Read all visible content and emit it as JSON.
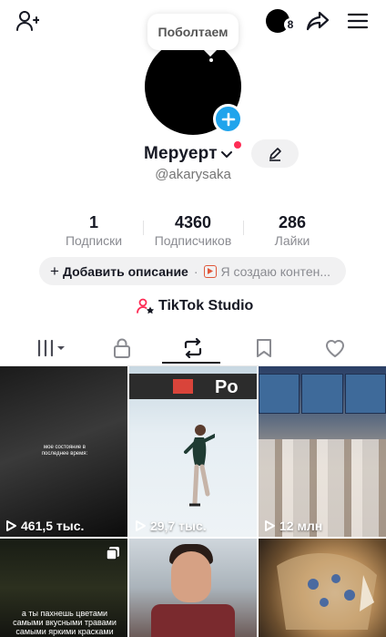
{
  "colors": {
    "accent_blue": "#20a4ec",
    "accent_red": "#fe2c55",
    "text_primary": "#161823",
    "text_secondary": "#8a8b91",
    "pill_bg": "#f1f1f2"
  },
  "topbar": {
    "icons": [
      "add-friend-icon",
      "story-avatar",
      "share-icon",
      "menu-icon"
    ],
    "story_badge_count": "8"
  },
  "profile": {
    "tooltip": "Поболтаем",
    "name": "Меруерт",
    "username": "@akarysaka"
  },
  "stats": [
    {
      "value": "1",
      "label": "Подписки"
    },
    {
      "value": "4360",
      "label": "Подписчиков"
    },
    {
      "value": "286",
      "label": "Лайки"
    }
  ],
  "bio": {
    "add_label": "Добавить описание",
    "separator": "·",
    "creator_text": "Я создаю контен..."
  },
  "studio": {
    "label": "TikTok Studio"
  },
  "tabs": [
    {
      "name": "videos",
      "icon": "grid-bars-icon",
      "selected": false
    },
    {
      "name": "private",
      "icon": "lock-icon",
      "selected": false
    },
    {
      "name": "reposts",
      "icon": "repost-icon",
      "selected": true
    },
    {
      "name": "favorites",
      "icon": "bookmark-icon",
      "selected": false
    },
    {
      "name": "liked",
      "icon": "heart-icon",
      "selected": false
    }
  ],
  "videos": [
    {
      "views": "461,5 тыс.",
      "caption": "мое состояние в последнее время:"
    },
    {
      "views": "29,7 тыс.",
      "caption": ""
    },
    {
      "views": "12 млн",
      "caption": ""
    },
    {
      "views": "",
      "caption": "а ты пахнешь цветами самыми вкусными травами самыми яркими красками"
    },
    {
      "views": "",
      "caption": ""
    },
    {
      "views": "",
      "caption": ""
    }
  ]
}
